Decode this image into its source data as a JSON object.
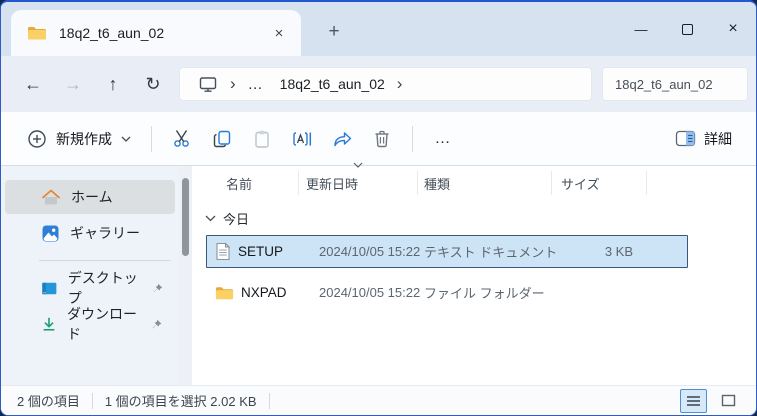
{
  "window": {
    "tab_title": "18q2_t6_aun_02",
    "controls": {
      "minimize": "—",
      "close": "×"
    },
    "new_tab": "+",
    "tab_close": "×"
  },
  "address_bar": {
    "back": "←",
    "forward": "→",
    "up": "↑",
    "refresh": "↻",
    "breadcrumb": {
      "ellipsis": "…",
      "chevron": "›",
      "folder": "18q2_t6_aun_02"
    },
    "search_value": "18q2_t6_aun_02"
  },
  "toolbar": {
    "new_label": "新規作成",
    "more": "…",
    "details_label": "詳細"
  },
  "sidebar": {
    "items": [
      {
        "label": "ホーム",
        "selected": true
      },
      {
        "label": "ギャラリー",
        "selected": false
      },
      {
        "label": "デスクトップ",
        "pinned": true
      },
      {
        "label": "ダウンロード",
        "pinned": true
      }
    ]
  },
  "file_list": {
    "columns": [
      "名前",
      "更新日時",
      "種類",
      "サイズ"
    ],
    "sorted_by": "更新日時",
    "group_label": "今日",
    "rows": [
      {
        "name": "SETUP",
        "modified": "2024/10/05 15:22",
        "type": "テキスト ドキュメント",
        "size": "3 KB",
        "icon": "text-document",
        "selected": true
      },
      {
        "name": "NXPAD",
        "modified": "2024/10/05 15:22",
        "type": "ファイル フォルダー",
        "size": "",
        "icon": "folder",
        "selected": false
      }
    ]
  },
  "status_bar": {
    "item_count": "2 個の項目",
    "selection_info": "1 個の項目を選択  2.02 KB"
  },
  "colors": {
    "accent_blue": "#2e5bc6",
    "titlebar_bg": "#d7e2f0",
    "selection_bg": "#cde4f7",
    "selection_border": "#39587b",
    "folder_yellow": "#f5b73c",
    "icon_blue": "#2a7ad4"
  }
}
